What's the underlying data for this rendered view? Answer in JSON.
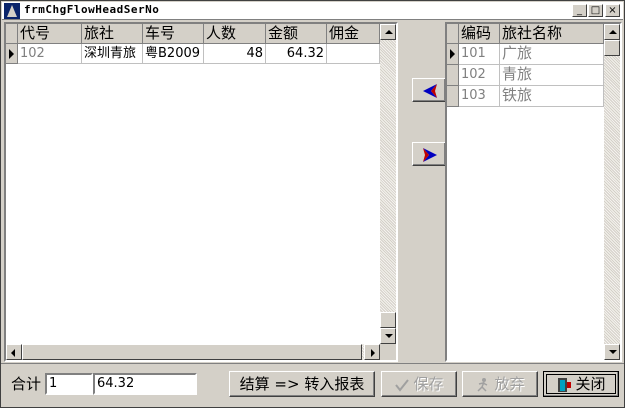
{
  "window": {
    "title": "frmChgFlowHeadSerNo"
  },
  "caption_buttons": {
    "minimize": "_",
    "maximize": "□",
    "close": "×"
  },
  "left_grid": {
    "columns": [
      "代号",
      "旅社",
      "车号",
      "人数",
      "金额",
      "佣金"
    ],
    "rows": [
      {
        "code": "102",
        "agency": "深圳青旅",
        "plate": "粤B2009",
        "people": "48",
        "amount": "64.32",
        "commission": ""
      }
    ]
  },
  "right_grid": {
    "columns": [
      "编码",
      "旅社名称"
    ],
    "rows": [
      {
        "code": "101",
        "name": "广旅"
      },
      {
        "code": "102",
        "name": "青旅"
      },
      {
        "code": "103",
        "name": "铁旅"
      }
    ]
  },
  "move_buttons": {
    "left_icon": "arrow-left-icon",
    "right_icon": "arrow-right-icon",
    "color": "#0000c0"
  },
  "footer": {
    "total_label": "合计",
    "count_value": "1",
    "amount_value": "64.32",
    "settle_button": "结算 => 转入报表",
    "save_button": "保存",
    "discard_button": "放弃",
    "close_button": "关闭"
  }
}
